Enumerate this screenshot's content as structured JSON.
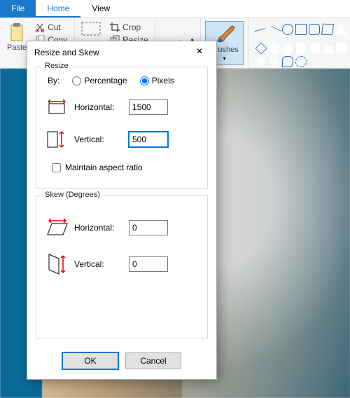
{
  "menu": {
    "file": "File",
    "home": "Home",
    "view": "View"
  },
  "ribbon": {
    "paste": "Paste",
    "cut": "Cut",
    "copy": "Copy",
    "crop": "Crop",
    "resize": "Resize",
    "brushes": "Brushes"
  },
  "dialog": {
    "title": "Resize and Skew",
    "resize": {
      "legend": "Resize",
      "by_label": "By:",
      "percentage": "Percentage",
      "pixels": "Pixels",
      "horizontal_label": "Horizontal:",
      "vertical_label": "Vertical:",
      "horizontal_value": "1500",
      "vertical_value": "500",
      "maintain": "Maintain aspect ratio"
    },
    "skew": {
      "legend": "Skew (Degrees)",
      "horizontal_label": "Horizontal:",
      "vertical_label": "Vertical:",
      "horizontal_value": "0",
      "vertical_value": "0"
    },
    "ok": "OK",
    "cancel": "Cancel"
  }
}
